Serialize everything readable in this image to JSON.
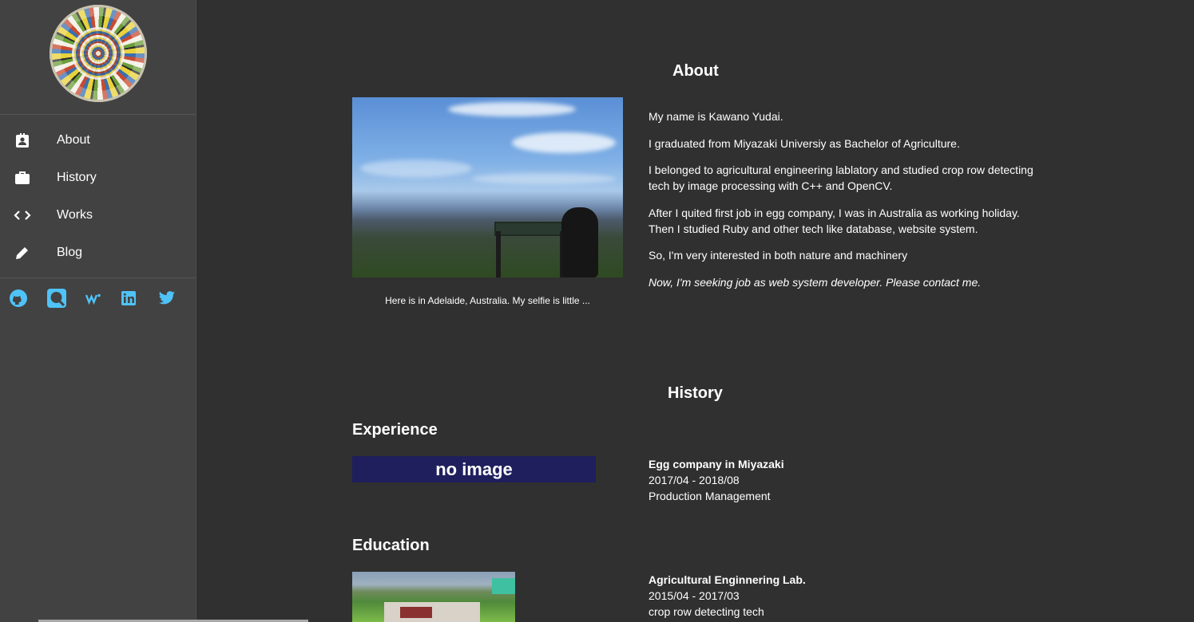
{
  "sidebar": {
    "items": [
      {
        "label": "About",
        "icon": "contact-card-icon"
      },
      {
        "label": "History",
        "icon": "briefcase-icon"
      },
      {
        "label": "Works",
        "icon": "code-brackets-icon"
      },
      {
        "label": "Blog",
        "icon": "pencil-icon"
      }
    ],
    "social": [
      "github-icon",
      "qiita-icon",
      "wantedly-icon",
      "linkedin-icon",
      "twitter-icon"
    ],
    "accent": "#4fc3f7"
  },
  "about": {
    "title": "About",
    "caption": "Here is in Adelaide, Australia. My selfie is little ...",
    "paragraphs": [
      "My name is Kawano Yudai.",
      "I graduated from Miyazaki Universiy as Bachelor of Agriculture.",
      "I belonged to agricultural engineering lablatory and studied crop row detecting tech by image processing with C++ and OpenCV.",
      "After I quited first job in egg company, I was in Australia as working holiday. Then I studied Ruby and other tech like database, website system.",
      "So, I'm very interested in both nature and machinery",
      "Now, I'm seeking job as web system developer. Please contact me."
    ]
  },
  "history": {
    "title": "History",
    "experience": {
      "title": "Experience",
      "no_image": "no image",
      "name": "Egg company in Miyazaki",
      "period": "2017/04 - 2018/08",
      "role": "Production Management"
    },
    "education": {
      "title": "Education",
      "name": "Agricultural Enginnering Lab.",
      "period": "2015/04 - 2017/03",
      "role": "crop row detecting tech"
    }
  }
}
